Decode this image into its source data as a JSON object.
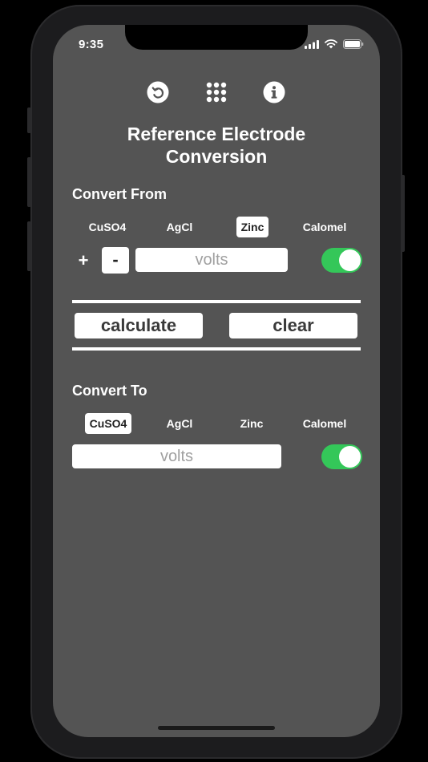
{
  "status_bar": {
    "time": "9:35"
  },
  "toolbar": {
    "icons": [
      "undo-icon",
      "grid-icon",
      "info-icon"
    ]
  },
  "title": {
    "line1": "Reference Electrode",
    "line2": "Conversion"
  },
  "convert_from": {
    "label": "Convert From",
    "options": [
      "CuSO4",
      "AgCl",
      "Zinc",
      "Calomel"
    ],
    "selected": "Zinc",
    "plus_label": "+",
    "minus_label": "-",
    "input_placeholder": "volts",
    "toggle_on": true
  },
  "actions": {
    "calculate_label": "calculate",
    "clear_label": "clear"
  },
  "convert_to": {
    "label": "Convert To",
    "options": [
      "CuSO4",
      "AgCl",
      "Zinc",
      "Calomel"
    ],
    "selected": "CuSO4",
    "output_placeholder": "volts",
    "toggle_on": true
  },
  "colors": {
    "screen_bg": "#545454",
    "toggle_on": "#34c759",
    "text": "#ffffff",
    "placeholder": "#a0a0a0"
  }
}
